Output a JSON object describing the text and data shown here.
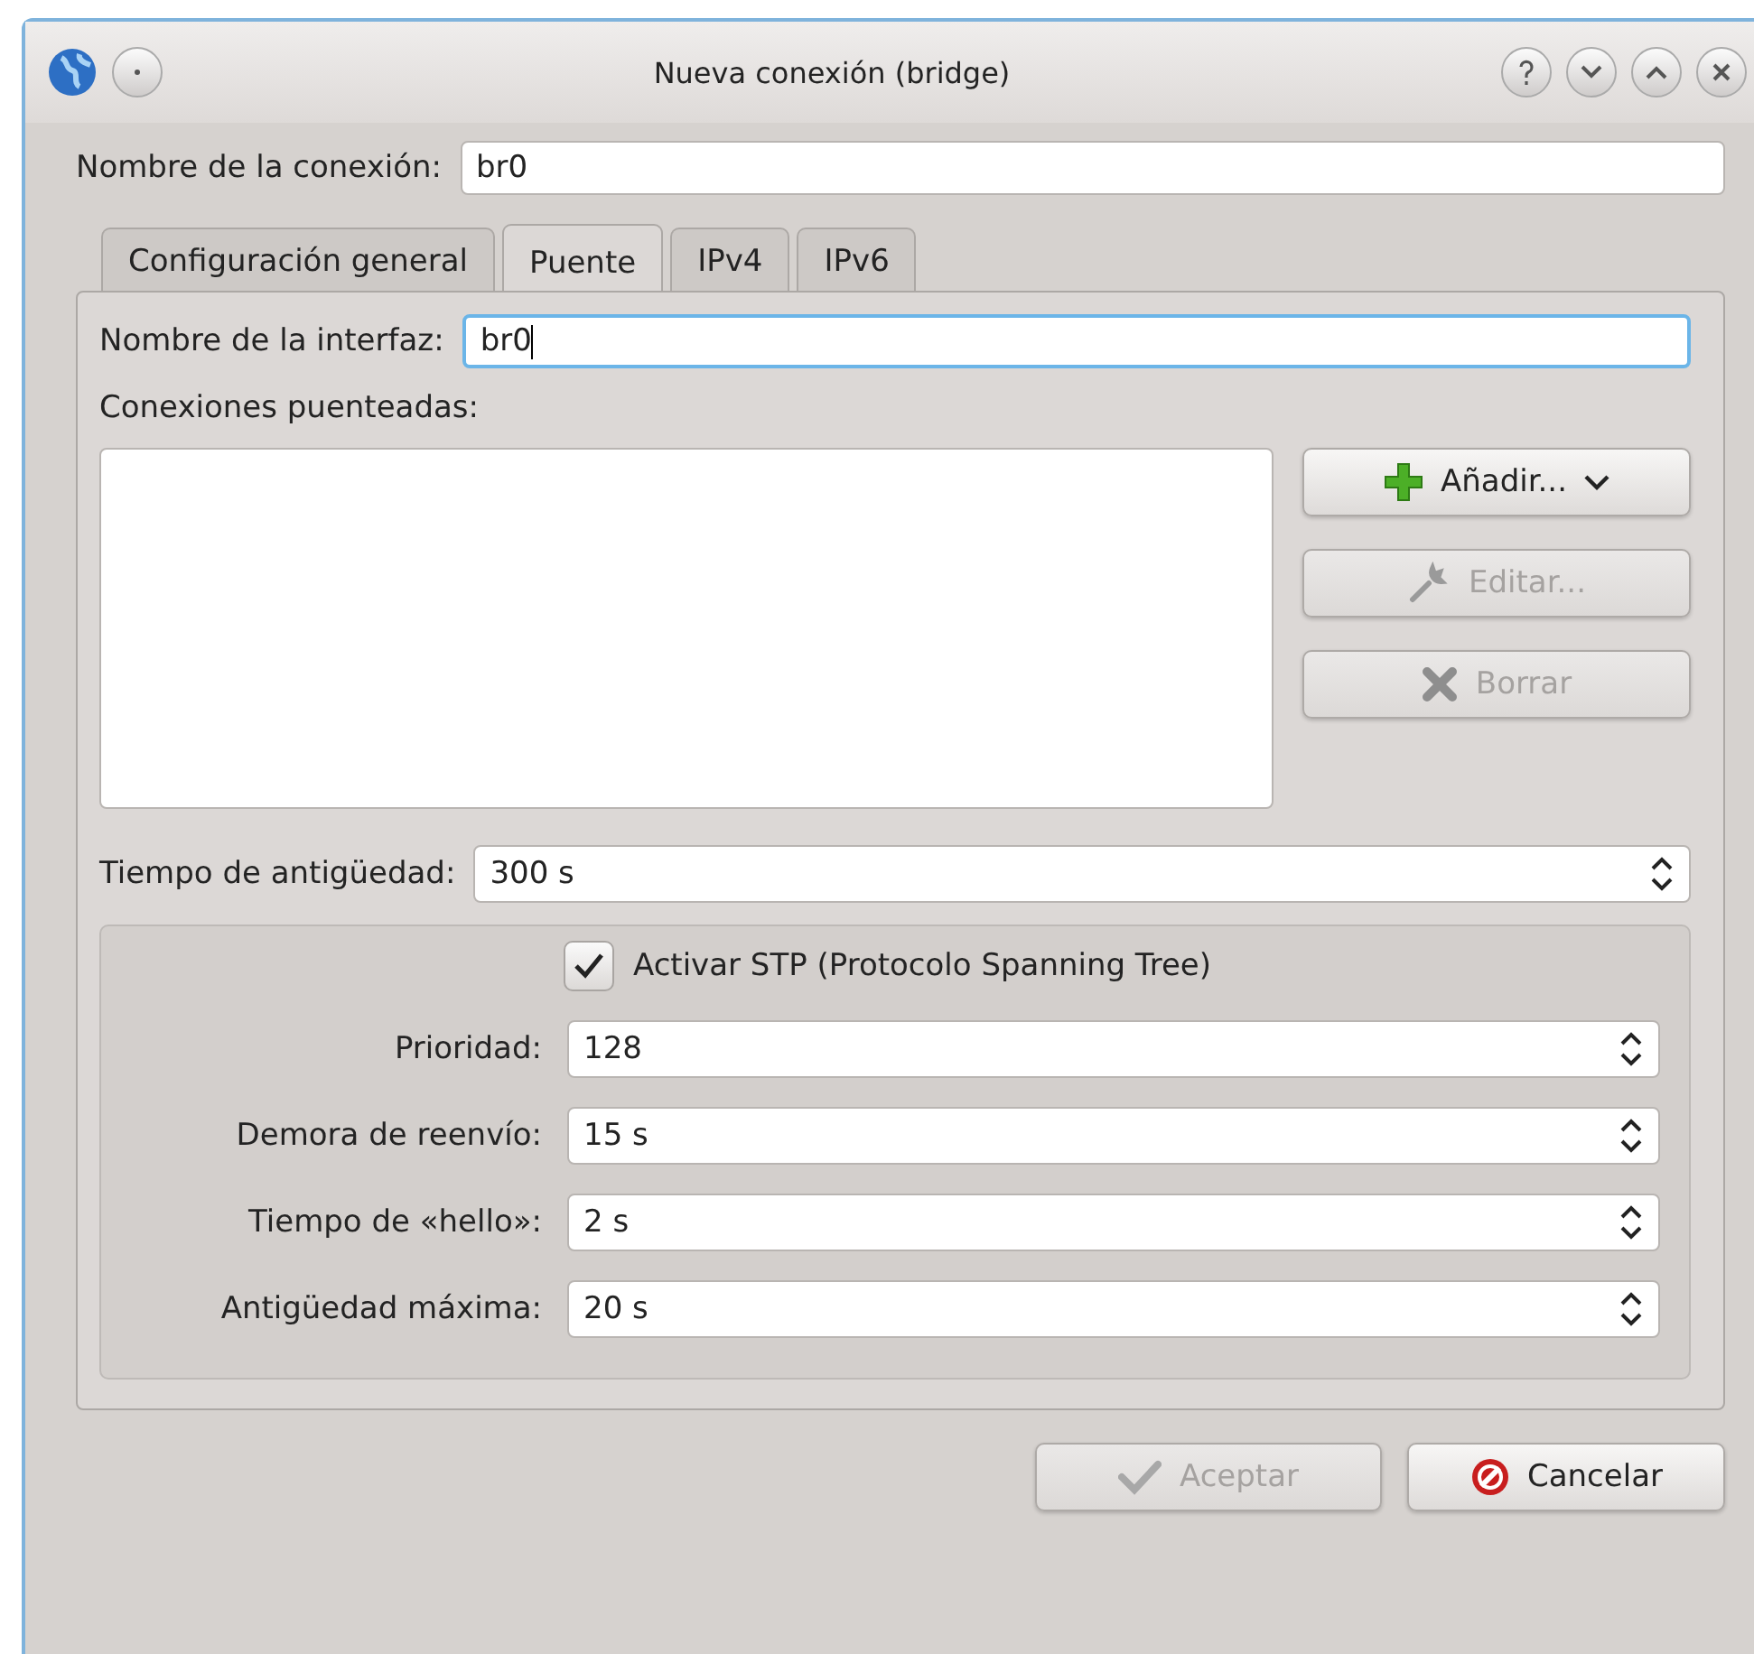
{
  "window": {
    "title": "Nueva conexión (bridge)"
  },
  "connection_name": {
    "label": "Nombre de la conexión:",
    "value": "br0"
  },
  "tabs": [
    {
      "label": "Configuración general",
      "selected": false
    },
    {
      "label": "Puente",
      "selected": true
    },
    {
      "label": "IPv4",
      "selected": false
    },
    {
      "label": "IPv6",
      "selected": false
    }
  ],
  "interface_name": {
    "label": "Nombre de la interfaz:",
    "value": "br0",
    "focused": true
  },
  "bridged_connections": {
    "label": "Conexiones puenteadas:"
  },
  "list_buttons": [
    {
      "label": "Añadir...",
      "kind": "add",
      "disabled": false
    },
    {
      "label": "Editar...",
      "kind": "edit",
      "disabled": true
    },
    {
      "label": "Borrar",
      "kind": "delete",
      "disabled": true
    }
  ],
  "aging_time": {
    "label": "Tiempo de antigüedad:",
    "value": "300 s"
  },
  "stp": {
    "label": "Activar STP (Protocolo Spanning Tree)",
    "checked": true,
    "fields": [
      {
        "label": "Prioridad:",
        "value": "128"
      },
      {
        "label": "Demora de reenvío:",
        "value": "15 s"
      },
      {
        "label": "Tiempo de «hello»:",
        "value": "2 s"
      },
      {
        "label": "Antigüedad máxima:",
        "value": "20 s"
      }
    ]
  },
  "buttons": [
    {
      "label": "Aceptar",
      "kind": "ok",
      "disabled": true
    },
    {
      "label": "Cancelar",
      "kind": "cancel",
      "disabled": false
    }
  ]
}
